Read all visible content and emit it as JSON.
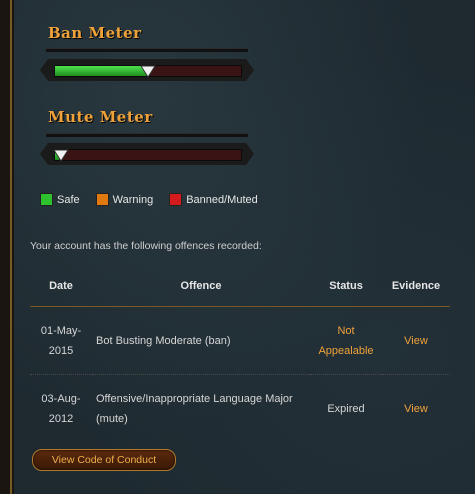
{
  "ban_meter": {
    "title": "Ban Meter",
    "level": 0.5,
    "accent": "#f0a23a"
  },
  "mute_meter": {
    "title": "Mute Meter",
    "level": 0.02
  },
  "legend": [
    {
      "label": "Safe",
      "color": "#2ec22e"
    },
    {
      "label": "Warning",
      "color": "#e07a10"
    },
    {
      "label": "Banned/Muted",
      "color": "#d41a1a"
    }
  ],
  "intro_text": "Your account has the following offences recorded:",
  "table": {
    "headers": {
      "date": "Date",
      "offence": "Offence",
      "status": "Status",
      "evidence": "Evidence"
    },
    "rows": [
      {
        "date": "01-May-2015",
        "offence": "Bot Busting Moderate (ban)",
        "status": "Not Appealable",
        "evidence": "View"
      },
      {
        "date": "03-Aug-2012",
        "offence": "Offensive/Inappropriate Language Major (mute)",
        "status": "Expired",
        "evidence": "View"
      }
    ]
  },
  "code_of_conduct_button": "View Code of Conduct"
}
